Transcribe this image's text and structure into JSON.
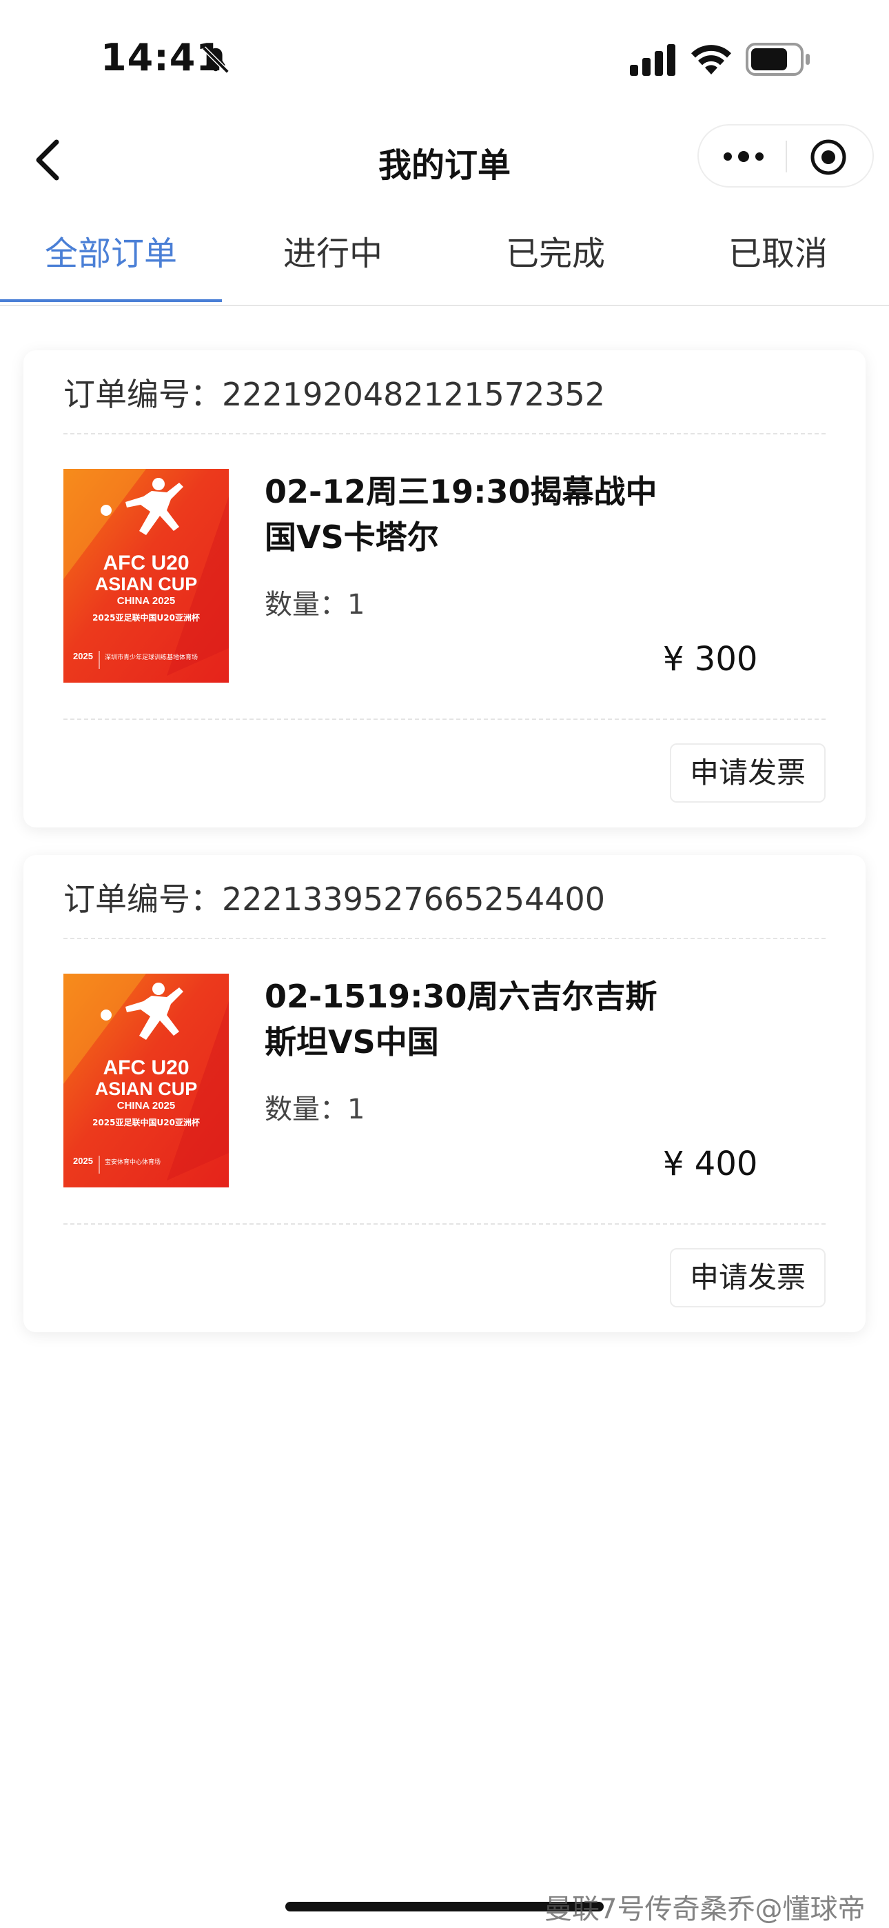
{
  "status_bar": {
    "time": "14:41"
  },
  "nav": {
    "title": "我的订单"
  },
  "tabs": [
    {
      "label": "全部订单",
      "active": true
    },
    {
      "label": "进行中",
      "active": false
    },
    {
      "label": "已完成",
      "active": false
    },
    {
      "label": "已取消",
      "active": false
    }
  ],
  "orders": [
    {
      "order_label": "订单编号：2221920482121572352",
      "title": "02-12周三19:30揭幕战中国VS卡塔尔",
      "quantity": "数量：1",
      "price": "¥  300",
      "invoice_label": "申请发票",
      "poster": {
        "line1": "AFC U20",
        "line2": "ASIAN CUP",
        "line3": "CHINA 2025",
        "line4": "2025亚足联中国U20亚洲杯",
        "year": "2025",
        "venue": "深圳市青少年足球训练基地体育场"
      }
    },
    {
      "order_label": "订单编号：2221339527665254400",
      "title": "02-1519:30周六吉尔吉斯斯坦VS中国",
      "quantity": "数量：1",
      "price": "¥  400",
      "invoice_label": "申请发票",
      "poster": {
        "line1": "AFC U20",
        "line2": "ASIAN CUP",
        "line3": "CHINA 2025",
        "line4": "2025亚足联中国U20亚洲杯",
        "year": "2025",
        "venue": "宝安体育中心体育场"
      }
    }
  ],
  "watermark": "曼联7号传奇桑乔@懂球帝",
  "colors": {
    "accent": "#4a7fd6",
    "poster_red": "#e5231b",
    "poster_orange": "#f57a18"
  }
}
